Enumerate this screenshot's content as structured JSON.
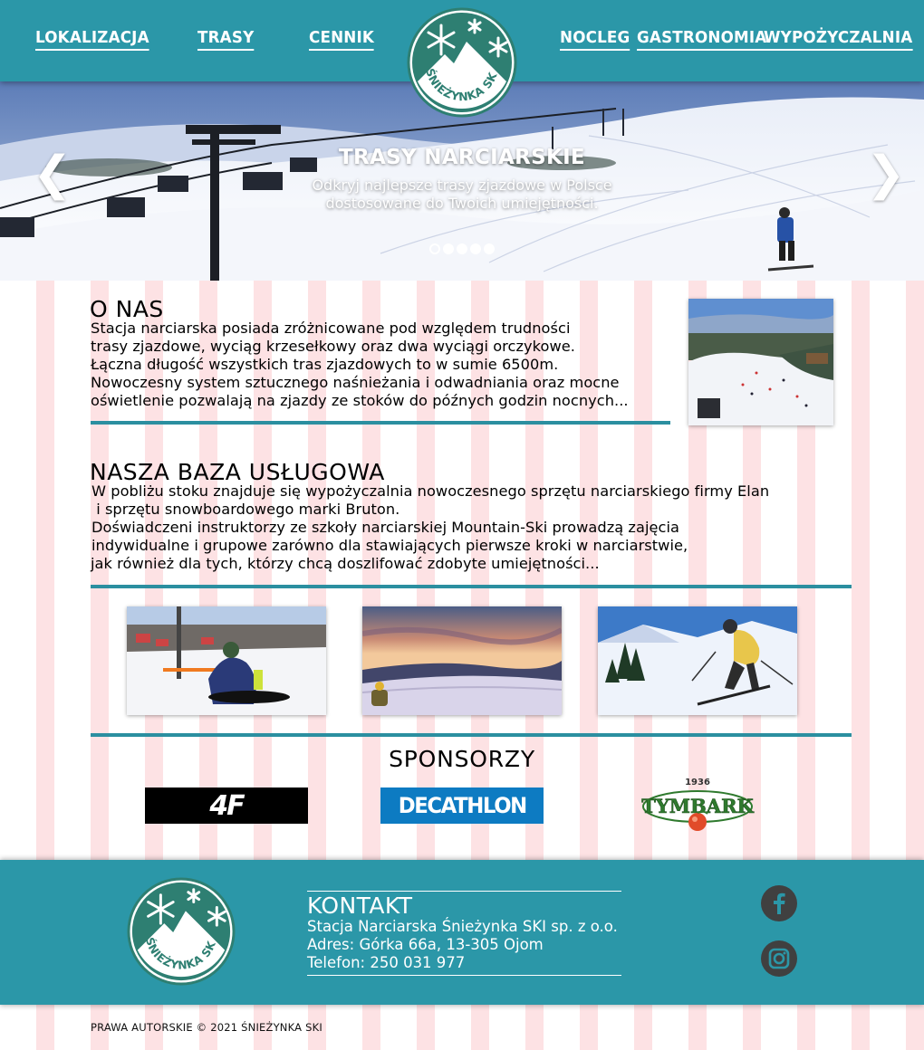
{
  "nav": {
    "left": [
      "LOKALIZACJA",
      "TRASY",
      "CENNIK"
    ],
    "right": [
      "NOCLEG",
      "GASTRONOMIA",
      "WYPOŻYCZALNIA"
    ]
  },
  "brand": {
    "name": "ŚNIEŻYNKA SKI"
  },
  "hero": {
    "title": "TRASY NARCIARSKIE",
    "subtitle_lines": [
      "Odkryj najlepsze trasy zjazdowe w Polsce",
      "dostosowane do Twoich umiejętności."
    ],
    "prev_arrow": "❮",
    "next_arrow": "❯",
    "slide_count": 5,
    "active_slide": 1
  },
  "about": {
    "title": "O NAS",
    "lines": [
      "Stacja narciarska posiada zróżnicowane pod względem trudności",
      "trasy zjazdowe, wyciąg krzesełkowy oraz dwa wyciągi orczykowe.",
      "Łączna długość wszystkich tras zjazdowych to w sumie 6500m.",
      "Nowoczesny system sztucznego naśnieżania i odwadniania oraz mocne",
      "oświetlenie pozwalają na zjazdy ze stoków do późnych godzin nocnych..."
    ]
  },
  "services": {
    "title": "NASZA BAZA USŁUGOWA",
    "lines": [
      "W pobliżu stoku znajduje się wypożyczalnia nowoczesnego sprzętu narciarskiego firmy Elan",
      " i sprzętu snowboardowego marki Bruton.",
      "Doświadczeni instruktorzy ze szkoły narciarskiej Mountain-Ski prowadzą zajęcia",
      "indywidualne i grupowe zarówno dla stawiających pierwsze kroki w narciarstwie,",
      "jak również dla tych, którzy chcą doszlifować zdobyte umiejętności..."
    ]
  },
  "sponsors": {
    "title": "SPONSORZY",
    "items": [
      {
        "name": "4F",
        "text": "4F"
      },
      {
        "name": "Decathlon",
        "text": "DECATHLON"
      },
      {
        "name": "Tymbark",
        "text": "TYMBARK",
        "year": "1936"
      }
    ]
  },
  "contact": {
    "title": "KONTAKT",
    "company": "Stacja Narciarska Śnieżynka SKI sp. z o.o.",
    "address": "Adres: Górka 66a, 13-305 Ojom",
    "phone": "Telefon: 250 031 977"
  },
  "social": [
    "facebook-icon",
    "instagram-icon"
  ],
  "footer": {
    "copyright": "PRAWA AUTORSKIE © 2021 ŚNIEŻYNKA SKI"
  },
  "colors": {
    "teal": "#2b97a8",
    "stripe_pink": "#fde2e4",
    "logo_green": "#2e7f72"
  }
}
